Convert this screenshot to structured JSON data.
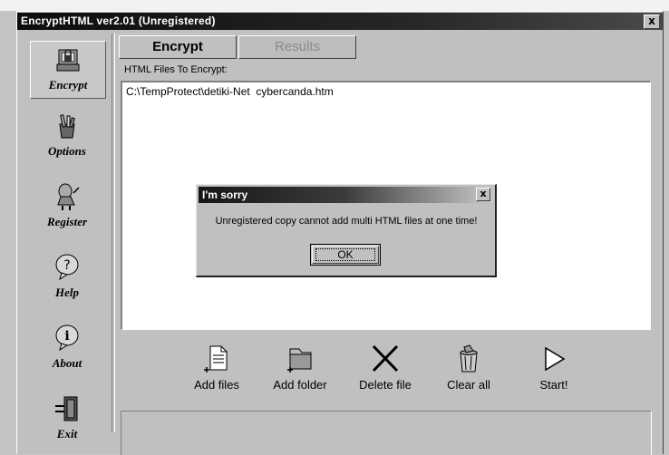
{
  "window": {
    "title": "EncryptHTML ver2.01 (Unregistered)",
    "close_glyph": "x"
  },
  "sidebar": {
    "items": [
      {
        "label": "Encrypt",
        "icon": "encrypt-icon",
        "active": true
      },
      {
        "label": "Options",
        "icon": "options-icon",
        "active": false
      },
      {
        "label": "Register",
        "icon": "register-icon",
        "active": false
      },
      {
        "label": "Help",
        "icon": "help-icon",
        "active": false
      },
      {
        "label": "About",
        "icon": "about-icon",
        "active": false
      },
      {
        "label": "Exit",
        "icon": "exit-icon",
        "active": false
      }
    ]
  },
  "tabs": [
    {
      "label": "Encrypt",
      "active": true
    },
    {
      "label": "Results",
      "active": false
    }
  ],
  "file_list": {
    "label": "HTML Files To Encrypt:",
    "items": [
      "C:\\TempProtect\\detiki-Net  cybercanda.htm"
    ]
  },
  "toolbar": {
    "buttons": [
      {
        "label": "Add files",
        "icon": "add-files-icon"
      },
      {
        "label": "Add folder",
        "icon": "add-folder-icon"
      },
      {
        "label": "Delete file",
        "icon": "delete-icon"
      },
      {
        "label": "Clear all",
        "icon": "recycle-bin-icon"
      },
      {
        "label": "Start!",
        "icon": "start-icon"
      }
    ]
  },
  "dialog": {
    "title": "I'm sorry",
    "message": "Unregistered copy cannot add multi HTML files at one time!",
    "ok_label": "OK",
    "close_glyph": "x"
  },
  "colors": {
    "titlebar": "#0d0d0d",
    "face": "#c0c0c0",
    "list_bg": "#ffffff"
  }
}
